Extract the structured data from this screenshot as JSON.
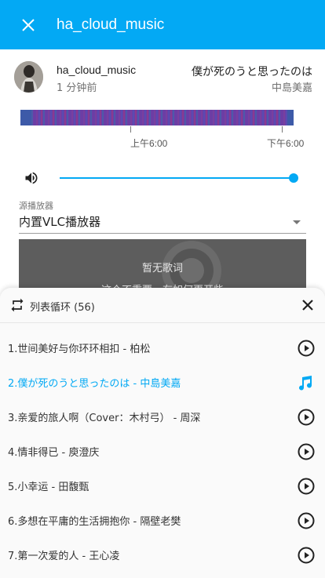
{
  "topbar": {
    "title": "ha_cloud_music",
    "close_icon": "close-icon"
  },
  "entity": {
    "name": "ha_cloud_music",
    "time": "1 分钟前",
    "song_title": "僕が死のうと思ったのは",
    "song_artist": "中島美嘉"
  },
  "history": {
    "tick_labels": [
      "上午6:00",
      "下午6:00"
    ],
    "bar_color": "#6a3fa8"
  },
  "volume": {
    "icon": "volume-up-icon",
    "level": 1.0
  },
  "source": {
    "label": "源播放器",
    "value": "内置VLC播放器"
  },
  "lyrics": {
    "line1": "暂无歌词",
    "line2": "这个不重要，有如何更开些"
  },
  "playlist": {
    "mode_label": "列表循环 (56)",
    "mode_icon": "repeat-icon",
    "accent": "#03a9f4",
    "tracks": [
      {
        "label": "1.世间美好与你环环相扣 - 柏松",
        "icon": "play-circle-icon"
      },
      {
        "label": "2.僕が死のうと思ったのは - 中島美嘉",
        "icon": "music-note-icon",
        "active": true
      },
      {
        "label": "3.亲爱的旅人啊（Cover：木村弓） - 周深",
        "icon": "play-circle-icon"
      },
      {
        "label": "4.情非得已 - 庾澄庆",
        "icon": "play-circle-icon"
      },
      {
        "label": "5.小幸运 - 田馥甄",
        "icon": "play-circle-icon"
      },
      {
        "label": "6.多想在平庸的生活拥抱你 - 隔壁老樊",
        "icon": "play-circle-icon"
      },
      {
        "label": "7.第一次爱的人 - 王心凌",
        "icon": "play-circle-icon"
      }
    ]
  }
}
